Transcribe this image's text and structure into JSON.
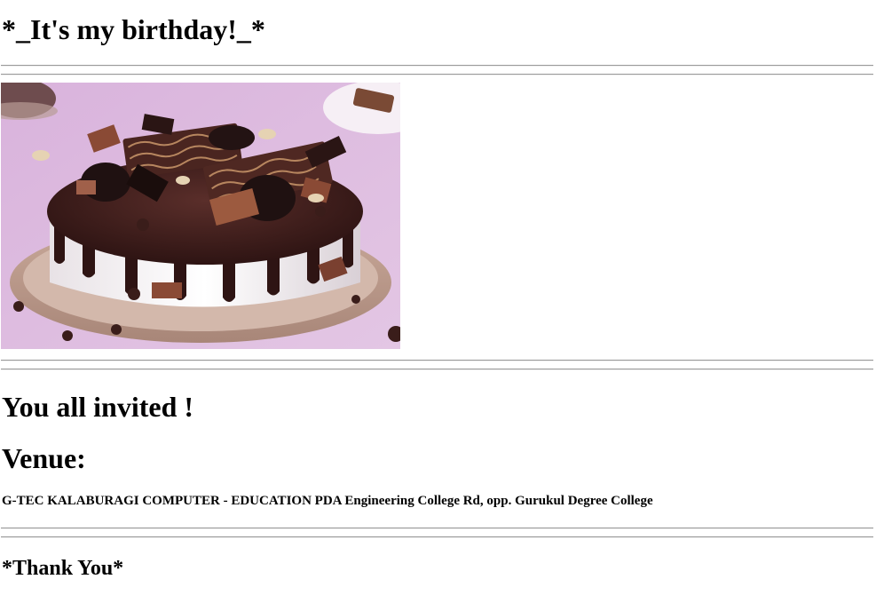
{
  "page": {
    "title": "*_It's my birthday!_*",
    "invite": "You all invited !",
    "venue_label": "Venue:",
    "venue_address": "G-TEC KALABURAGI COMPUTER - EDUCATION PDA Engineering College Rd, opp. Gurukul Degree College",
    "closing": "*Thank You*"
  },
  "image": {
    "subject": "chocolate-cake-photo"
  },
  "colors": {
    "text": "#000000",
    "background": "#ffffff",
    "rule": "#9a9a9a",
    "photo_background": "#dcb8df",
    "chocolate": "#3b1f1d",
    "cream": "#f4f1f3"
  }
}
